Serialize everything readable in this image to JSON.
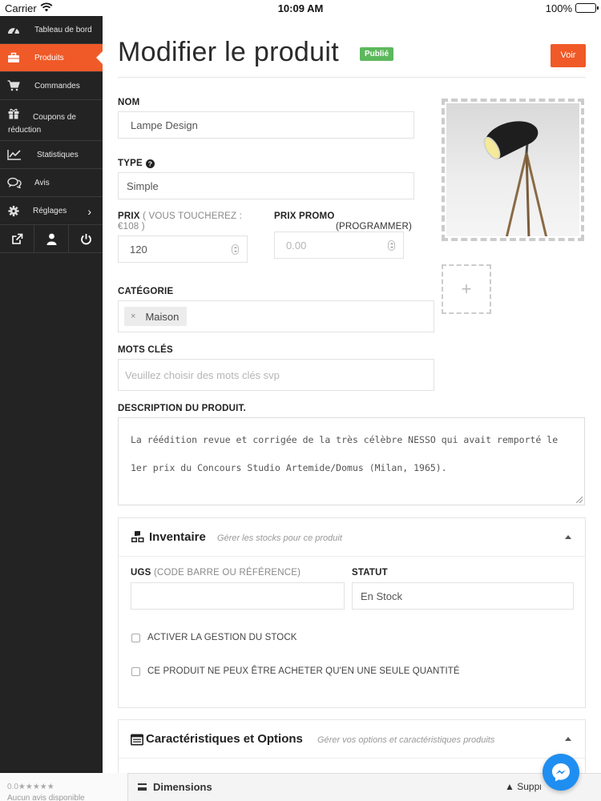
{
  "status_bar": {
    "carrier": "Carrier",
    "time": "10:09 AM",
    "battery": "100%"
  },
  "sidebar": {
    "items": [
      {
        "label": "Tableau de bord",
        "icon": "dashboard-icon"
      },
      {
        "label": "Produits",
        "icon": "briefcase-icon",
        "active": true
      },
      {
        "label": "Commandes",
        "icon": "cart-icon"
      },
      {
        "label": "Coupons de réduction",
        "icon": "gift-icon"
      },
      {
        "label": "Statistiques",
        "icon": "line-chart-icon"
      },
      {
        "label": "Avis",
        "icon": "comments-icon"
      },
      {
        "label": "Réglages",
        "icon": "gear-icon",
        "chevron": "›"
      }
    ],
    "bottom_icons": [
      "external-link-icon",
      "user-icon",
      "power-icon"
    ]
  },
  "header": {
    "title": "Modifier le produit",
    "badge": "Publié",
    "view_button": "Voir"
  },
  "form": {
    "name_label": "NOM",
    "name_value": "Lampe Design",
    "type_label": "TYPE",
    "type_value": "Simple",
    "price_label": "PRIX",
    "price_hint": "( VOUS TOUCHEREZ : €108 )",
    "price_value": "120",
    "promo_label": "PRIX PROMO",
    "promo_schedule": "(PROGRAMMER)",
    "promo_placeholder": "0.00",
    "category_label": "CATÉGORIE",
    "category_tag": "Maison",
    "category_tag_remove": "×",
    "keywords_label": "MOTS CLÉS",
    "keywords_placeholder": "Veuillez choisir des mots clés svp",
    "description_label": "DESCRIPTION DU PRODUIT.",
    "description_line1": "La réédition revue et corrigée de la très célèbre NESSO qui avait remporté le",
    "description_line2": "1er prix du Concours Studio Artemide/Domus (Milan, 1965).",
    "add_image": "+"
  },
  "inventory": {
    "title": "Inventaire",
    "subtitle": "Gérer les stocks pour ce produit",
    "sku_label": "UGS",
    "sku_hint": "(CODE BARRE OU RÉFÉRENCE)",
    "sku_value": "",
    "status_label": "STATUT",
    "status_value": "En Stock",
    "check_manage_stock": "ACTIVER LA GESTION DU STOCK",
    "check_single_qty": "CE PRODUIT NE PEUX ÊTRE ACHETER QU'EN UNE SEULE QUANTITÉ"
  },
  "features": {
    "title": "Caractéristiques et Options",
    "subtitle": "Gérer vos options et caractéristiques produits"
  },
  "bottom": {
    "rating": "0.0★★★★★",
    "no_reviews": "Aucun avis disponible",
    "dimensions": "Dimensions",
    "delete": "▲ Supprimer"
  },
  "colors": {
    "accent": "#f05a28",
    "sidebar_bg": "#232323",
    "published": "#5cb85c",
    "messenger": "#1f8ef1"
  }
}
